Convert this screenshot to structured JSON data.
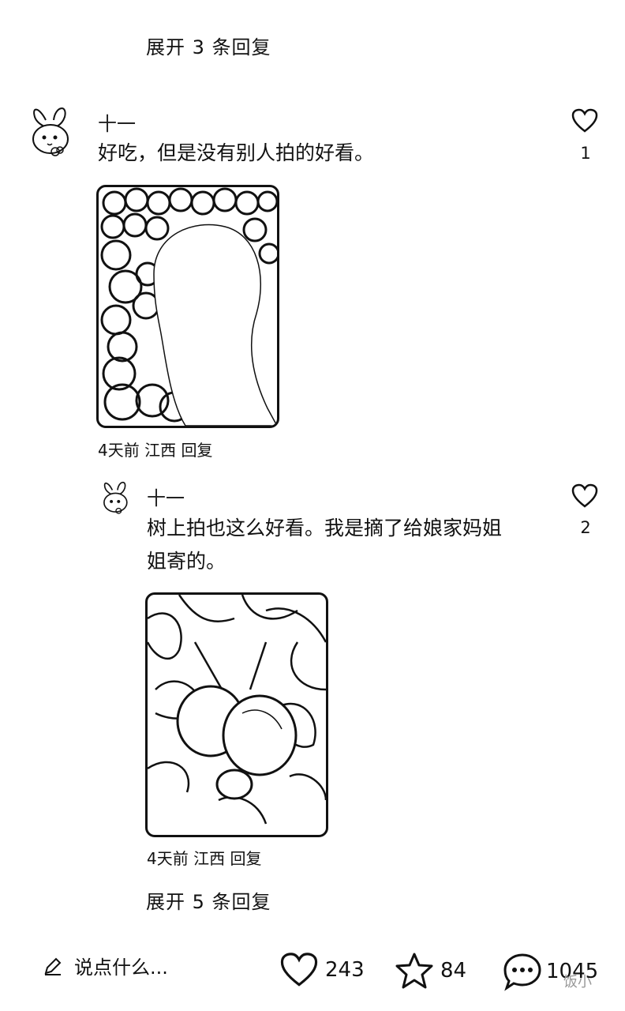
{
  "top_thread": {
    "expand_label": "展开 3 条回复"
  },
  "comment1": {
    "username": "十一",
    "text": "好吃，但是没有别人拍的好看。",
    "like_count": "1",
    "meta": "4天前 江西 回复",
    "photo_icon": "oranges-basket-photo"
  },
  "reply1": {
    "username": "十一",
    "text_line1": "树上拍也这么好看。我是摘了给娘家妈姐",
    "text_line2": "姐寄的。",
    "like_count": "2",
    "meta": "4天前 江西 回复",
    "photo_icon": "oranges-on-tree-photo"
  },
  "sub_thread": {
    "expand_label": "展开 5 条回复"
  },
  "bottom_bar": {
    "comment_placeholder": "说点什么...",
    "likes": "243",
    "favorites": "84",
    "comments": "1045",
    "watermark": "饭小"
  }
}
